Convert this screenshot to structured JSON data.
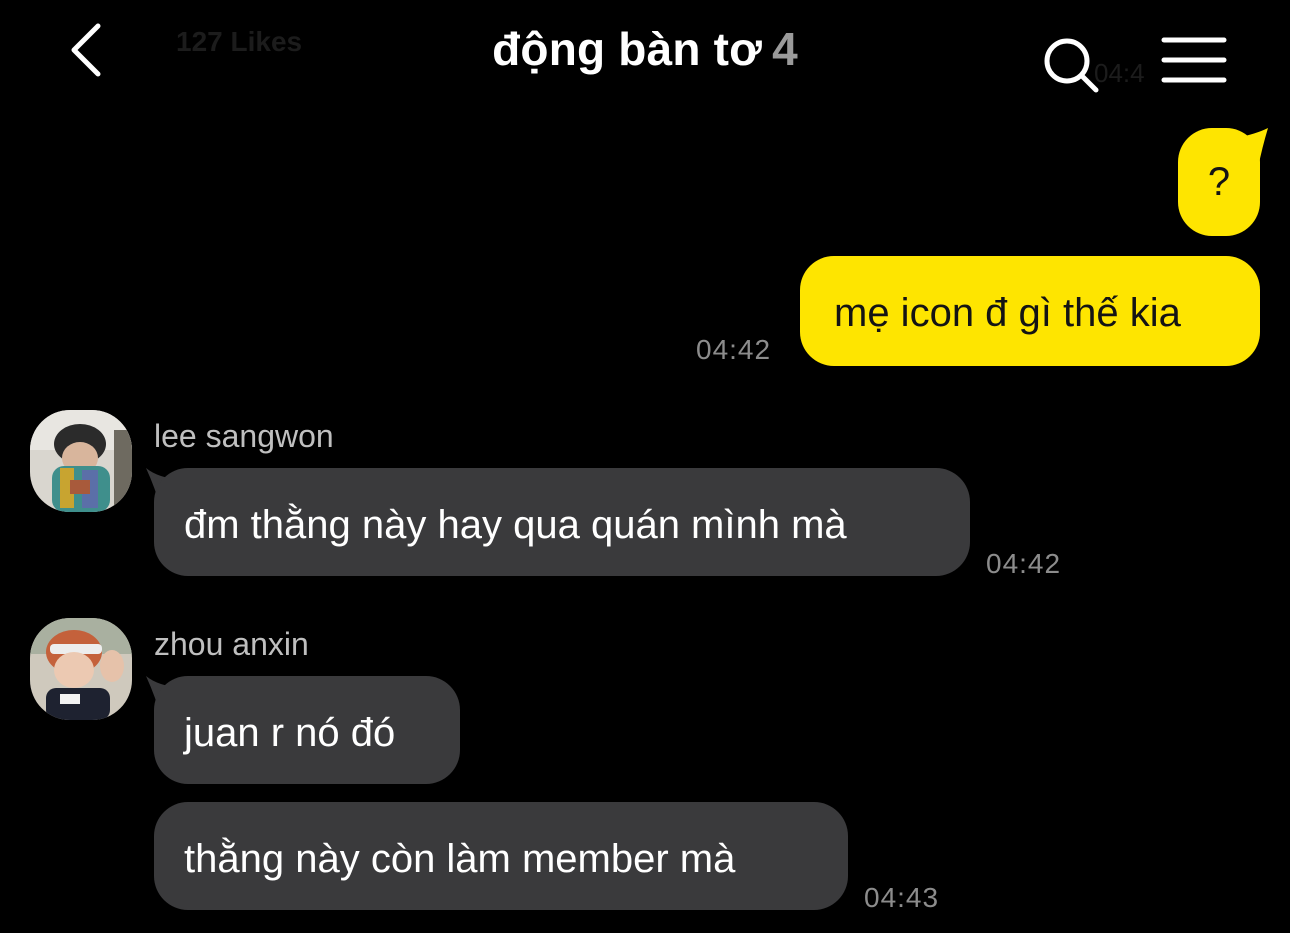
{
  "header": {
    "back_icon": "chevron-left-icon",
    "title": "động bàn tơ",
    "member_count": "4",
    "search_icon": "search-icon",
    "menu_icon": "hamburger-menu-icon",
    "ghost_likes": "127 Likes",
    "ghost_time": "04:4"
  },
  "colors": {
    "background": "#000000",
    "my_bubble": "#fee500",
    "other_bubble": "#3a3a3c",
    "timestamp": "#8c8c8c",
    "count": "#9a9a9a"
  },
  "messages": {
    "m1": {
      "text": "?"
    },
    "m2": {
      "text": "mẹ icon đ gì thế kia",
      "time": "04:42"
    },
    "m3": {
      "sender": "lee sangwon",
      "text": "đm thằng này hay qua quán mình mà",
      "time": "04:42"
    },
    "m4": {
      "sender": "zhou anxin",
      "text": "juan r nó đó"
    },
    "m5": {
      "text": "thằng này còn làm member mà",
      "time": "04:43"
    }
  }
}
